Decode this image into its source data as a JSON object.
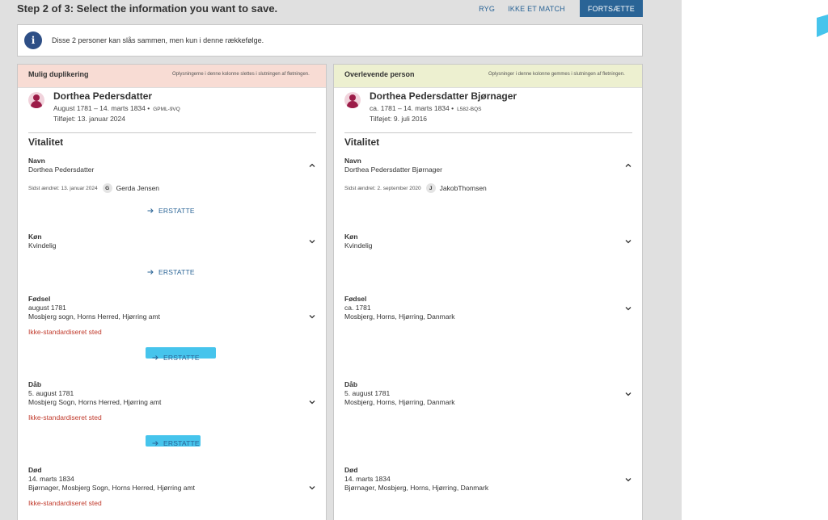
{
  "header": {
    "title": "Step 2 of 3: Select the information you want to save.",
    "back_label": "RYG",
    "not_match_label": "IKKE ET MATCH",
    "continue_label": "FORTSÆTTE"
  },
  "info": {
    "icon": "info-icon",
    "text": "Disse 2 personer kan slås sammen, men kun i denne rækkefølge."
  },
  "left": {
    "title": "Mulig duplikering",
    "note": "Oplysningerne i denne kolonne slettes i slutningen af fletningen.",
    "person": {
      "name": "Dorthea Pedersdatter",
      "dates": "August 1781 – 14. marts 1834 •",
      "id": "GPML-9VQ",
      "added": "Tilføjet: 13. januar 2024"
    },
    "section": "Vitalitet",
    "name_fact": {
      "label": "Navn",
      "value": "Dorthea Pedersdatter",
      "changed": "Sidst ændret: 13. januar 2024",
      "user_initial": "G",
      "user_name": "Gerda Jensen"
    },
    "sex_fact": {
      "label": "Køn",
      "value": "Kvindelig"
    },
    "birth_fact": {
      "label": "Fødsel",
      "date": "august 1781",
      "place": "Mosbjerg sogn, Horns Herred, Hjørring amt",
      "warning": "Ikke-standardiseret sted"
    },
    "baptism_fact": {
      "label": "Dåb",
      "date": "5. august 1781",
      "place": "Mosbjerg Sogn, Horns Herred, Hjørring amt",
      "warning": "Ikke-standardiseret sted"
    },
    "death_fact": {
      "label": "Død",
      "date": "14. marts 1834",
      "place": "Bjørnager, Mosbjerg Sogn, Horns Herred, Hjørring amt",
      "warning": "Ikke-standardiseret sted"
    },
    "replace_label": "ERSTATTE"
  },
  "right": {
    "title": "Overlevende person",
    "note": "Oplysninger i denne kolonne gemmes i slutningen af fletningen.",
    "person": {
      "name": "Dorthea Pedersdatter Bjørnager",
      "dates": "ca. 1781 – 14. marts 1834 •",
      "id": "L582-BQS",
      "added": "Tilføjet: 9. juli 2016"
    },
    "section": "Vitalitet",
    "name_fact": {
      "label": "Navn",
      "value": "Dorthea Pedersdatter Bjørnager",
      "changed": "Sidst ændret: 2. september 2020",
      "user_initial": "J",
      "user_name": "JakobThomsen"
    },
    "sex_fact": {
      "label": "Køn",
      "value": "Kvindelig"
    },
    "birth_fact": {
      "label": "Fødsel",
      "date": "ca. 1781",
      "place": "Mosbjerg, Horns, Hjørring, Danmark"
    },
    "baptism_fact": {
      "label": "Dåb",
      "date": "5. august 1781",
      "place": "Mosbjerg, Horns, Hjørring, Danmark"
    },
    "death_fact": {
      "label": "Død",
      "date": "14. marts 1834",
      "place": "Bjørnager, Mosbjerg, Horns, Hjørring, Danmark"
    }
  },
  "colors": {
    "accent": "#2a6496",
    "left_header": "#f8dcd4",
    "right_header": "#edf0d0",
    "warning": "#c0392b",
    "highlight": "#46c4ec"
  }
}
